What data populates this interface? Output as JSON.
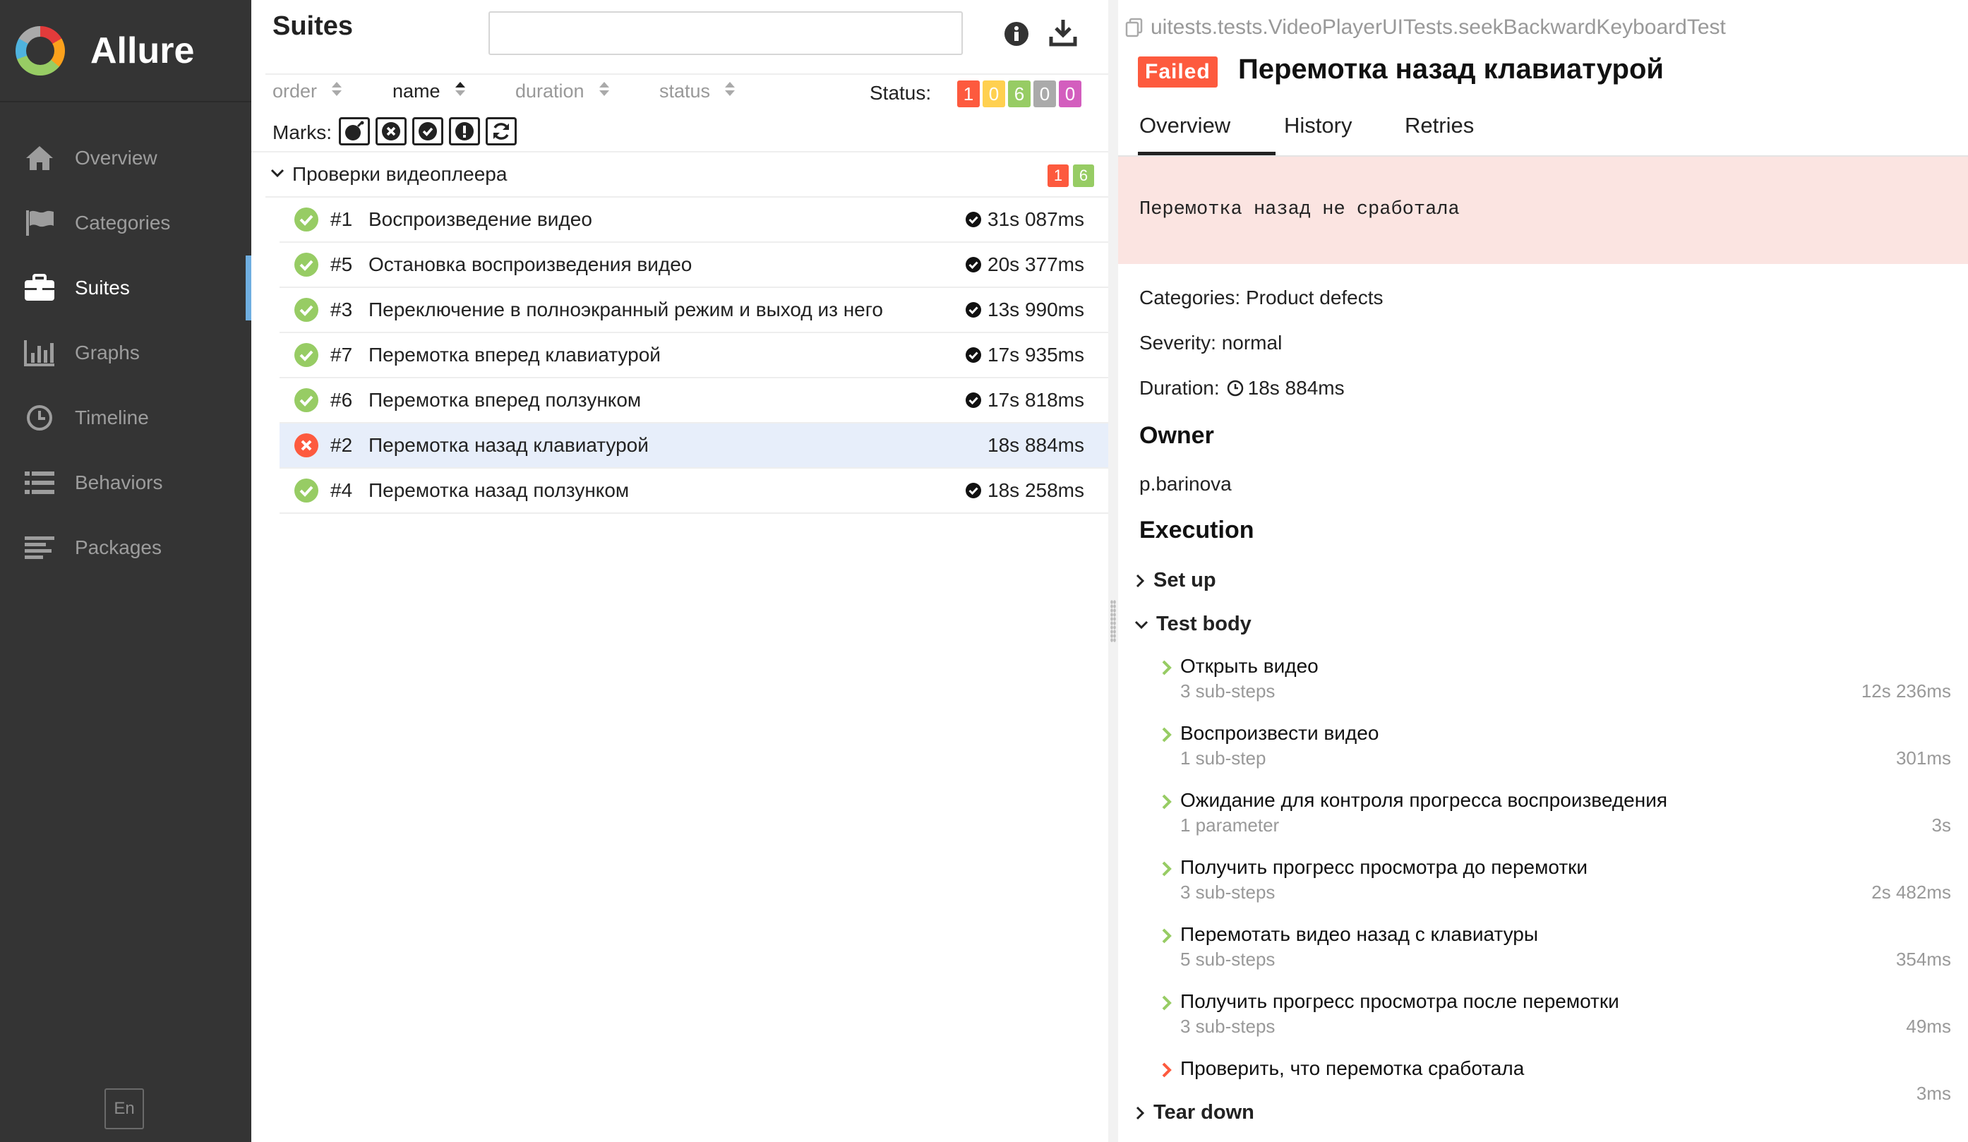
{
  "app": {
    "title": "Allure",
    "lang": "En"
  },
  "nav": [
    {
      "label": "Overview",
      "icon": "home-icon"
    },
    {
      "label": "Categories",
      "icon": "flag-icon"
    },
    {
      "label": "Suites",
      "icon": "briefcase-icon",
      "active": true
    },
    {
      "label": "Graphs",
      "icon": "bar-chart-icon"
    },
    {
      "label": "Timeline",
      "icon": "clock-icon"
    },
    {
      "label": "Behaviors",
      "icon": "list-icon"
    },
    {
      "label": "Packages",
      "icon": "align-left-icon"
    }
  ],
  "suites": {
    "title": "Suites",
    "search": {
      "value": "",
      "placeholder": ""
    },
    "sort": {
      "order": "order",
      "name": "name",
      "duration": "duration",
      "status": "status"
    },
    "status_label": "Status:",
    "status_counts": [
      {
        "value": "1",
        "color": "#fd5a3e"
      },
      {
        "value": "0",
        "color": "#ffd050"
      },
      {
        "value": "6",
        "color": "#97cc64"
      },
      {
        "value": "0",
        "color": "#aaaaaa"
      },
      {
        "value": "0",
        "color": "#d35ebe"
      }
    ],
    "marks_label": "Marks:",
    "group": {
      "name": "Проверки видеоплеера",
      "failed": "1",
      "passed": "6"
    },
    "rows": [
      {
        "num": "#1",
        "name": "Воспроизведение видео",
        "duration": "31s 087ms",
        "status": "passed"
      },
      {
        "num": "#5",
        "name": "Остановка воспроизведения видео",
        "duration": "20s 377ms",
        "status": "passed"
      },
      {
        "num": "#3",
        "name": "Переключение в полноэкранный режим и выход из него",
        "duration": "13s 990ms",
        "status": "passed"
      },
      {
        "num": "#7",
        "name": "Перемотка вперед клавиатурой",
        "duration": "17s 935ms",
        "status": "passed"
      },
      {
        "num": "#6",
        "name": "Перемотка вперед ползунком",
        "duration": "17s 818ms",
        "status": "passed"
      },
      {
        "num": "#2",
        "name": "Перемотка назад клавиатурой",
        "duration": "18s 884ms",
        "status": "failed"
      },
      {
        "num": "#4",
        "name": "Перемотка назад ползунком",
        "duration": "18s 258ms",
        "status": "passed"
      }
    ]
  },
  "detail": {
    "path": "uitests.tests.VideoPlayerUITests.seekBackwardKeyboardTest",
    "status": "Failed",
    "title": "Перемотка назад клавиатурой",
    "tabs": [
      "Overview",
      "History",
      "Retries"
    ],
    "error": "Перемотка назад не сработала",
    "categories": "Categories: Product defects",
    "severity": "Severity: normal",
    "duration_label": "Duration:",
    "duration": "18s 884ms",
    "owner_heading": "Owner",
    "owner": "p.barinova",
    "execution_heading": "Execution",
    "setup": "Set up",
    "test_body": "Test body",
    "teardown": "Tear down",
    "steps": [
      {
        "name": "Открыть видео",
        "sub": "3 sub-steps",
        "time": "12s 236ms",
        "status": "passed"
      },
      {
        "name": "Воспроизвести видео",
        "sub": "1 sub-step",
        "time": "301ms",
        "status": "passed"
      },
      {
        "name": "Ожидание для контроля прогресса воспроизведения",
        "sub": "1 parameter",
        "time": "3s",
        "status": "passed"
      },
      {
        "name": "Получить прогресс просмотра до перемотки",
        "sub": "3 sub-steps",
        "time": "2s 482ms",
        "status": "passed"
      },
      {
        "name": "Перемотать видео назад с клавиатуры",
        "sub": "5 sub-steps",
        "time": "354ms",
        "status": "passed"
      },
      {
        "name": "Получить прогресс просмотра после перемотки",
        "sub": "3 sub-steps",
        "time": "49ms",
        "status": "passed"
      },
      {
        "name": "Проверить, что перемотка сработала",
        "sub": "",
        "time": "3ms",
        "status": "failed"
      }
    ]
  }
}
